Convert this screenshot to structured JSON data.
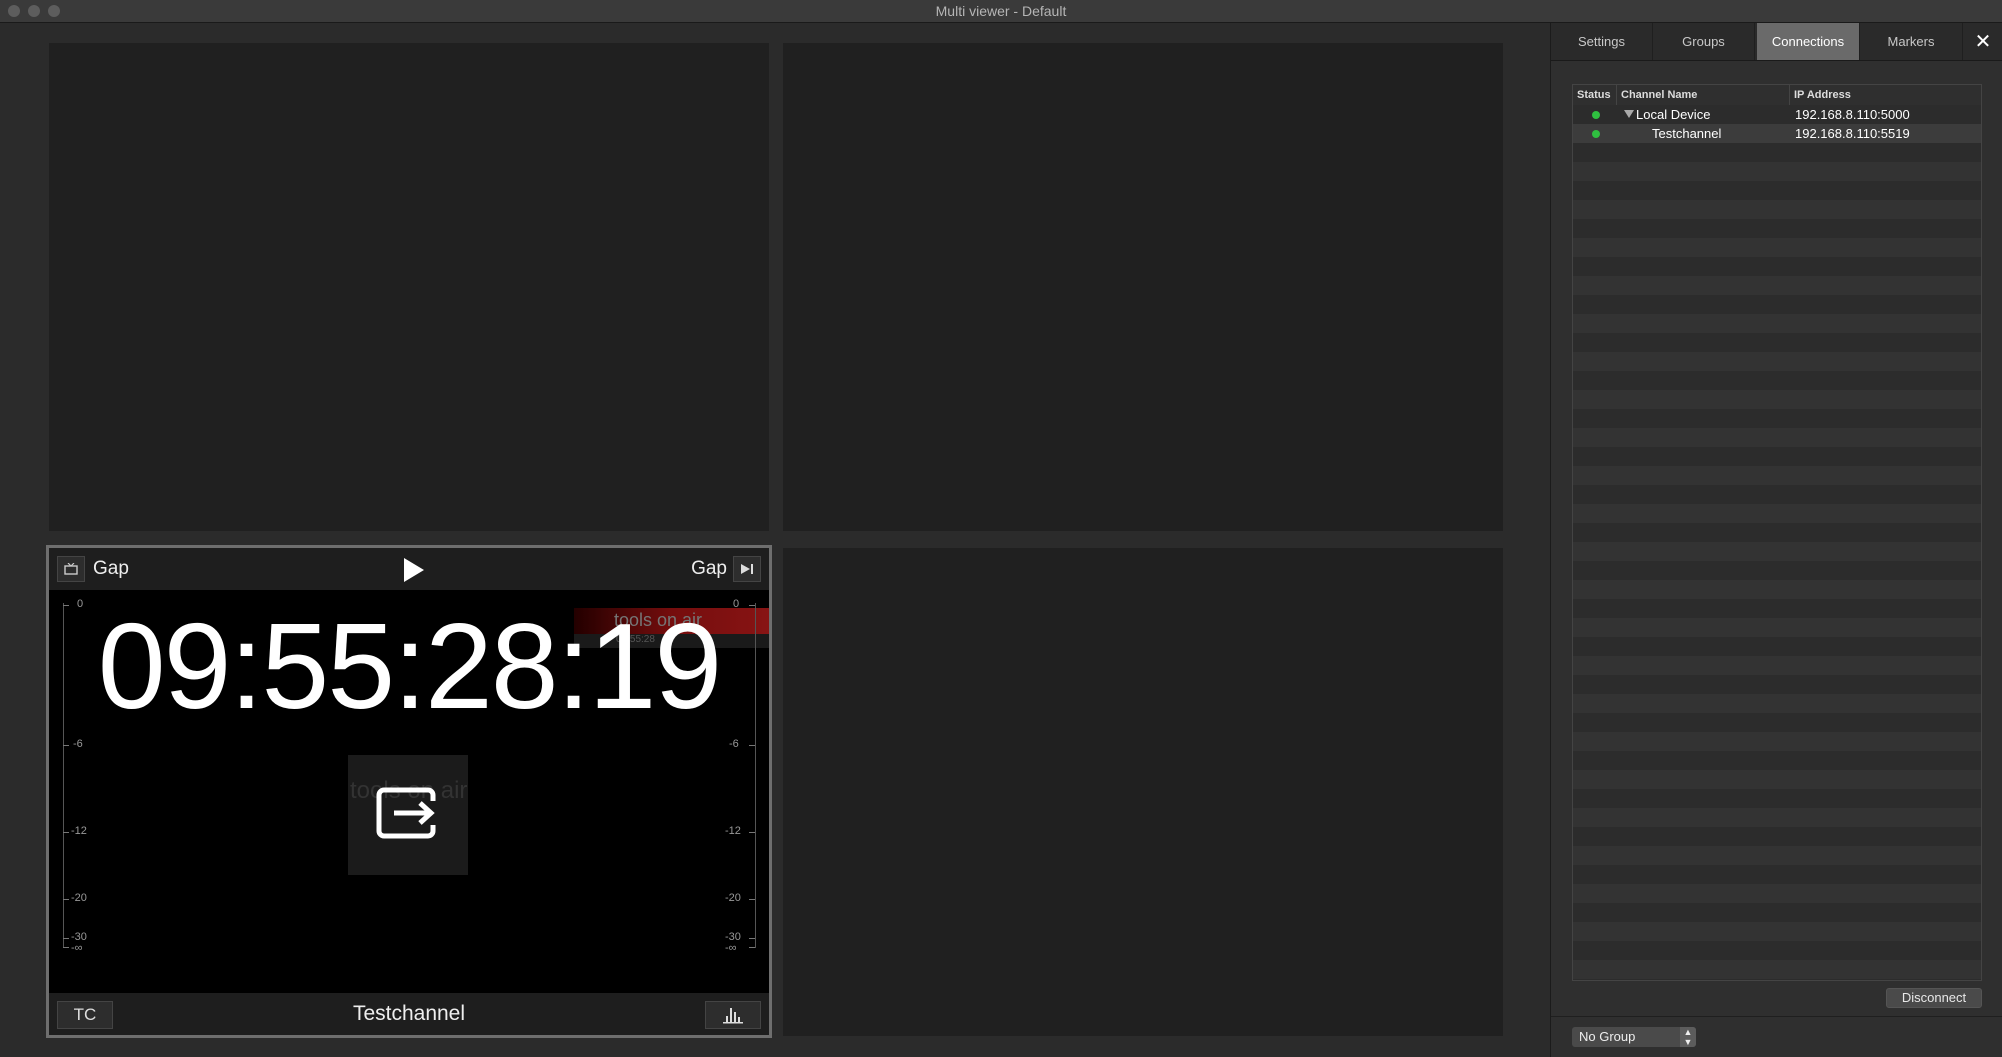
{
  "window": {
    "title": "Multi viewer - Default"
  },
  "active_channel": {
    "left_label": "Gap",
    "right_label": "Gap",
    "timecode": "09:55:28:19",
    "tc_button": "TC",
    "channel_name": "Testchannel",
    "watermark_text": "tools on air",
    "watermark_tc": "09:55:28"
  },
  "meter_scale": [
    "0",
    "-6",
    "-12",
    "-20",
    "-30",
    "-∞"
  ],
  "panel": {
    "tabs": [
      {
        "label": "Settings",
        "active": false
      },
      {
        "label": "Groups",
        "active": false
      },
      {
        "label": "Connections",
        "active": true
      },
      {
        "label": "Markers",
        "active": false
      }
    ],
    "close_icon": "✕",
    "table": {
      "headers": {
        "status": "Status",
        "channel_name": "Channel Name",
        "ip": "IP Address"
      },
      "rows": [
        {
          "name": "Local Device",
          "ip": "192.168.8.110:5000",
          "status": "online",
          "level": 0
        },
        {
          "name": "Testchannel",
          "ip": "192.168.8.110:5519",
          "status": "online",
          "level": 1
        }
      ]
    },
    "disconnect_label": "Disconnect",
    "group_select": "No Group"
  },
  "colors": {
    "status_online": "#2fbf40",
    "active_tab": "#6a6a6a"
  }
}
